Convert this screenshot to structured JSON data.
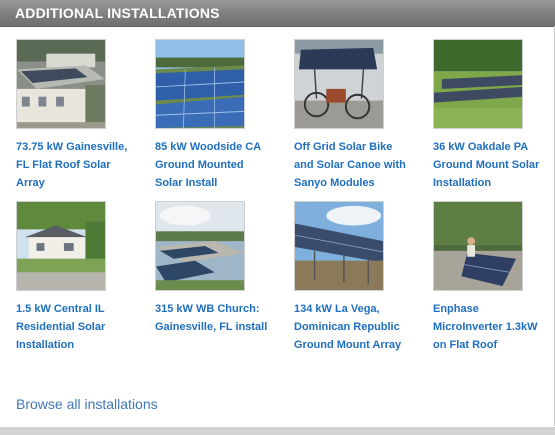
{
  "header": {
    "title": "ADDITIONAL INSTALLATIONS"
  },
  "installations": [
    {
      "line1": "73.75 kW Gainesville,",
      "line2": "FL Flat Roof Solar",
      "line3": "Array",
      "image_icon": "flat-roof-solar-photo"
    },
    {
      "line1": "85 kW Woodside CA",
      "line2": "Ground Mounted",
      "line3": "Solar Install",
      "image_icon": "ground-mount-solar-photo"
    },
    {
      "line1": "Off Grid Solar Bike",
      "line2": "and Solar Canoe with",
      "line3": "Sanyo Modules",
      "image_icon": "solar-bike-photo"
    },
    {
      "line1": "36 kW Oakdale PA",
      "line2": "Ground Mount Solar",
      "line3": "Installation",
      "image_icon": "ground-mount-field-photo"
    },
    {
      "line1": "1.5 kW Central IL",
      "line2": "Residential Solar",
      "line3": "Installation",
      "image_icon": "residential-house-photo"
    },
    {
      "line1": "315 kW WB Church:",
      "line2": "Gainesville, FL install",
      "line3": "",
      "image_icon": "church-aerial-photo"
    },
    {
      "line1": "134 kW La Vega,",
      "line2": "Dominican Republic",
      "line3": "Ground Mount Array",
      "image_icon": "ground-array-clouds-photo"
    },
    {
      "line1": "Enphase",
      "line2": "MicroInverter 1.3kW",
      "line3": "on Flat Roof",
      "image_icon": "rooftop-installer-photo"
    }
  ],
  "footer": {
    "browse_link": "Browse all installations"
  }
}
